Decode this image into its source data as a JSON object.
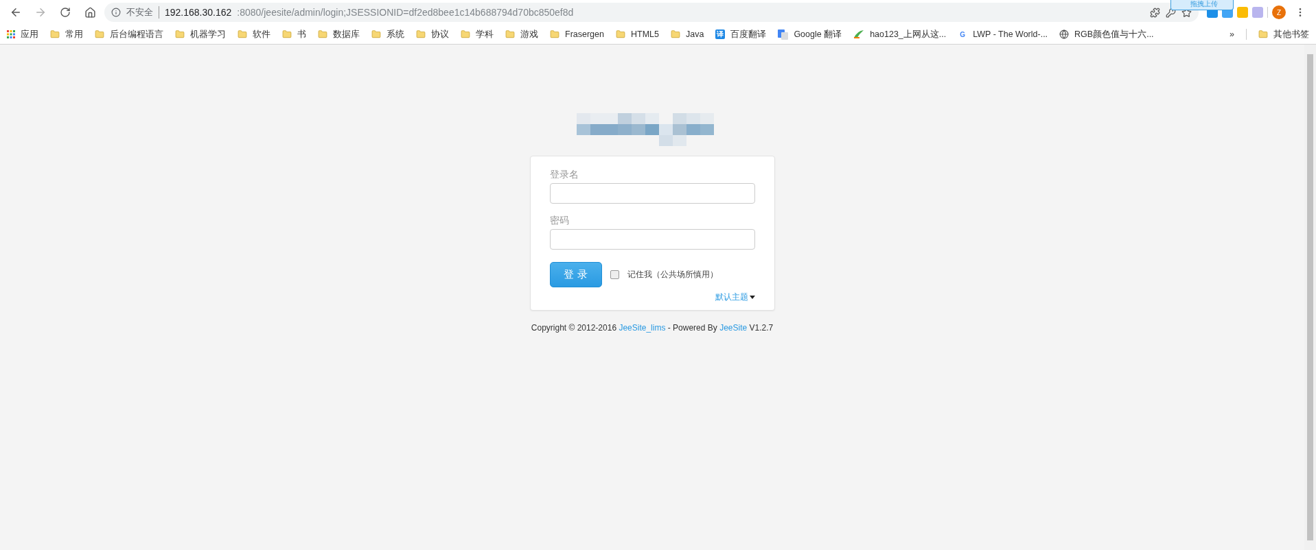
{
  "browser": {
    "security_label": "不安全",
    "url_host": "192.168.30.162",
    "url_path": ":8080/jeesite/admin/login;JSESSIONID=df2ed8bee1c14b688794d70bc850ef8d",
    "forward_disabled": true,
    "avatar_letter": "Z",
    "extension_popup": "拖拽上传"
  },
  "bookmarks": [
    {
      "kind": "apps",
      "label": "应用"
    },
    {
      "kind": "folder",
      "label": "常用"
    },
    {
      "kind": "folder",
      "label": "后台编程语言"
    },
    {
      "kind": "folder",
      "label": "机器学习"
    },
    {
      "kind": "folder",
      "label": "软件"
    },
    {
      "kind": "folder",
      "label": "书"
    },
    {
      "kind": "folder",
      "label": "数据库"
    },
    {
      "kind": "folder",
      "label": "系统"
    },
    {
      "kind": "folder",
      "label": "协议"
    },
    {
      "kind": "folder",
      "label": "学科"
    },
    {
      "kind": "folder",
      "label": "游戏"
    },
    {
      "kind": "folder",
      "label": "Frasergen"
    },
    {
      "kind": "folder",
      "label": "HTML5"
    },
    {
      "kind": "folder",
      "label": "Java"
    },
    {
      "kind": "translate",
      "label": "百度翻译",
      "glyph": "译"
    },
    {
      "kind": "google-translate",
      "label": "Google 翻译"
    },
    {
      "kind": "hao",
      "label": "hao123_上网从这..."
    },
    {
      "kind": "google",
      "label": "LWP - The World-...",
      "glyph": "G"
    },
    {
      "kind": "globe",
      "label": "RGB颜色值与十六..."
    }
  ],
  "bookmarks_overflow": "»",
  "other_bookmarks": "其他书签",
  "login": {
    "username_label": "登录名",
    "password_label": "密码",
    "submit": "登 录",
    "remember_label": "记住我（公共场所慎用）",
    "remember_checked": false,
    "theme_link": "默认主题"
  },
  "footer": [
    {
      "kind": "text",
      "text": "Copyright © 2012-2016 "
    },
    {
      "kind": "link",
      "text": "JeeSite_lims"
    },
    {
      "kind": "text",
      "text": " - Powered By "
    },
    {
      "kind": "link",
      "text": "JeeSite"
    },
    {
      "kind": "text",
      "text": " V1.2.7"
    }
  ]
}
